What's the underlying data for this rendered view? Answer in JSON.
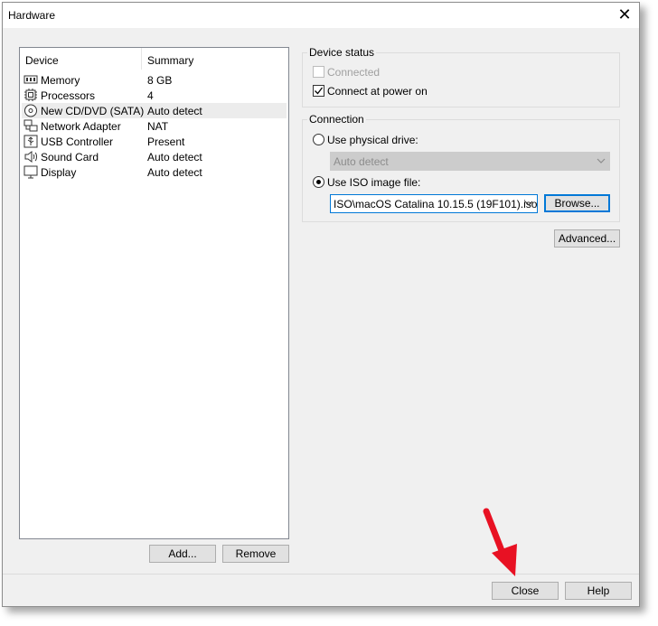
{
  "window": {
    "title": "Hardware",
    "close_glyph": "✕"
  },
  "list": {
    "columns": {
      "device": "Device",
      "summary": "Summary"
    },
    "rows": [
      {
        "device": "Memory",
        "summary": "8 GB",
        "icon": "memory-icon"
      },
      {
        "device": "Processors",
        "summary": "4",
        "icon": "processor-icon"
      },
      {
        "device": "New CD/DVD (SATA)",
        "summary": "Auto detect",
        "icon": "cd-dvd-icon",
        "selected": true
      },
      {
        "device": "Network Adapter",
        "summary": "NAT",
        "icon": "network-icon"
      },
      {
        "device": "USB Controller",
        "summary": "Present",
        "icon": "usb-icon"
      },
      {
        "device": "Sound Card",
        "summary": "Auto detect",
        "icon": "speaker-icon"
      },
      {
        "device": "Display",
        "summary": "Auto detect",
        "icon": "monitor-icon"
      }
    ]
  },
  "list_buttons": {
    "add": "Add...",
    "remove": "Remove"
  },
  "device_status": {
    "label": "Device status",
    "connected": {
      "label": "Connected",
      "checked": false,
      "enabled": false
    },
    "connect_at_power_on": {
      "label": "Connect at power on",
      "checked": true
    }
  },
  "connection": {
    "label": "Connection",
    "physical": {
      "label": "Use physical drive:",
      "selected": false,
      "combo_value": "Auto detect"
    },
    "iso": {
      "label": "Use ISO image file:",
      "selected": true,
      "path_value": "ISO\\macOS Catalina 10.15.5 (19F101).iso",
      "browse_label": "Browse..."
    }
  },
  "advanced_label": "Advanced...",
  "footer": {
    "close": "Close",
    "help": "Help"
  },
  "annotation": {
    "arrow_color": "#e81123"
  }
}
